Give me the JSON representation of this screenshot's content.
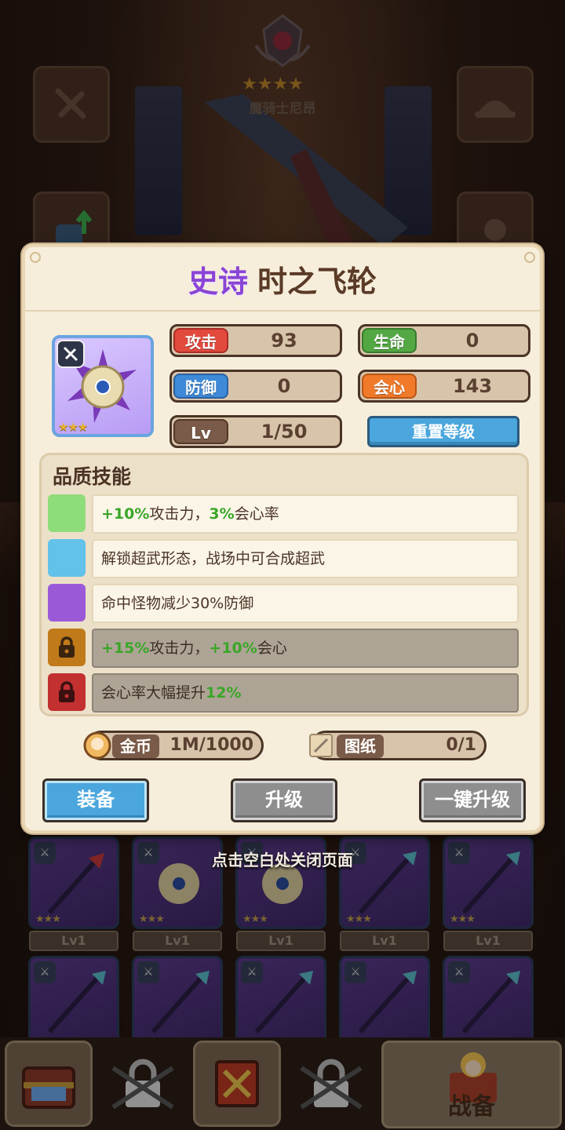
{
  "hero": {
    "name": "魔骑士尼昂",
    "stars": "★★★★"
  },
  "modal": {
    "rarity": "史诗",
    "item_name": "时之飞轮",
    "item_stars": "★★★",
    "stats": {
      "attack": {
        "label": "攻击",
        "value": "93"
      },
      "hp": {
        "label": "生命",
        "value": "0"
      },
      "defense": {
        "label": "防御",
        "value": "0"
      },
      "crit": {
        "label": "会心",
        "value": "143"
      },
      "level": {
        "label": "Lv",
        "value": "1/50"
      }
    },
    "reset_label": "重置等级",
    "skills_title": "品质技能",
    "skills": [
      {
        "color": "#8fdc7a",
        "locked": false,
        "parts": [
          "",
          "+10%",
          "攻击力，",
          "3%",
          "会心率"
        ]
      },
      {
        "color": "#62c2ea",
        "locked": false,
        "parts": [
          "解锁超武形态，战场中可合成超武",
          "",
          "",
          "",
          ""
        ]
      },
      {
        "color": "#9a5ad8",
        "locked": false,
        "parts": [
          "命中怪物减少30%防御",
          "",
          "",
          "",
          ""
        ]
      },
      {
        "color": "#c07a1a",
        "locked": true,
        "parts": [
          "",
          "+15%",
          "攻击力，",
          "+10%",
          "会心"
        ]
      },
      {
        "color": "#c23030",
        "locked": true,
        "parts": [
          "会心率大幅提升",
          "12%",
          "",
          "",
          ""
        ]
      }
    ],
    "resources": {
      "gold": {
        "label": "金币",
        "value": "1M/1000"
      },
      "blueprint": {
        "label": "图纸",
        "value": "0/1"
      }
    },
    "buttons": {
      "equip": "装备",
      "upgrade": "升级",
      "one_click": "一键升级"
    }
  },
  "close_hint": "点击空白处关闭页面",
  "inventory": {
    "levels": [
      "Lv1",
      "Lv1",
      "Lv1",
      "Lv1",
      "Lv1"
    ],
    "stars": "★★★"
  },
  "bottom_nav": {
    "battle_label": "战备"
  }
}
